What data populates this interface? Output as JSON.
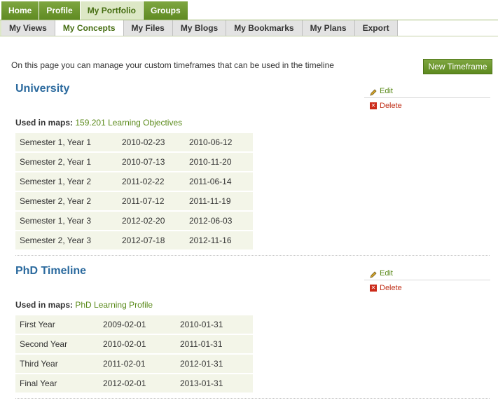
{
  "main_nav": {
    "tabs": [
      {
        "label": "Home",
        "selected": false
      },
      {
        "label": "Profile",
        "selected": false
      },
      {
        "label": "My Portfolio",
        "selected": true
      },
      {
        "label": "Groups",
        "selected": false
      }
    ]
  },
  "sub_nav": {
    "tabs": [
      {
        "label": "My Views",
        "selected": false
      },
      {
        "label": "My Concepts",
        "selected": true
      },
      {
        "label": "My Files",
        "selected": false
      },
      {
        "label": "My Blogs",
        "selected": false
      },
      {
        "label": "My Bookmarks",
        "selected": false
      },
      {
        "label": "My Plans",
        "selected": false
      },
      {
        "label": "Export",
        "selected": false
      }
    ]
  },
  "intro": {
    "text": "On this page you can manage your custom timeframes that can be used in the timeline",
    "new_button": "New Timeframe"
  },
  "actions": {
    "edit_label": "Edit",
    "delete_label": "Delete",
    "used_label": "Used in maps:"
  },
  "colors": {
    "accent_green": "#5f8a22",
    "title_blue": "#2b6a9e",
    "delete_red": "#c0311a",
    "row_bg": "#f3f5e8"
  },
  "timeframes": [
    {
      "title": "University",
      "used_in": "159.201 Learning Objectives",
      "rows": [
        {
          "name": "Semester 1, Year 1",
          "start": "2010-02-23",
          "end": "2010-06-12"
        },
        {
          "name": "Semester 2, Year 1",
          "start": "2010-07-13",
          "end": "2010-11-20"
        },
        {
          "name": "Semester 1, Year 2",
          "start": "2011-02-22",
          "end": "2011-06-14"
        },
        {
          "name": "Semester 2, Year 2",
          "start": "2011-07-12",
          "end": "2011-11-19"
        },
        {
          "name": "Semester 1, Year 3",
          "start": "2012-02-20",
          "end": "2012-06-03"
        },
        {
          "name": "Semester 2, Year 3",
          "start": "2012-07-18",
          "end": "2012-11-16"
        }
      ]
    },
    {
      "title": "PhD Timeline",
      "used_in": "PhD Learning Profile",
      "rows": [
        {
          "name": "First Year",
          "start": "2009-02-01",
          "end": "2010-01-31"
        },
        {
          "name": "Second Year",
          "start": "2010-02-01",
          "end": "2011-01-31"
        },
        {
          "name": "Third Year",
          "start": "2011-02-01",
          "end": "2012-01-31"
        },
        {
          "name": "Final Year",
          "start": "2012-02-01",
          "end": "2013-01-31"
        }
      ]
    }
  ]
}
